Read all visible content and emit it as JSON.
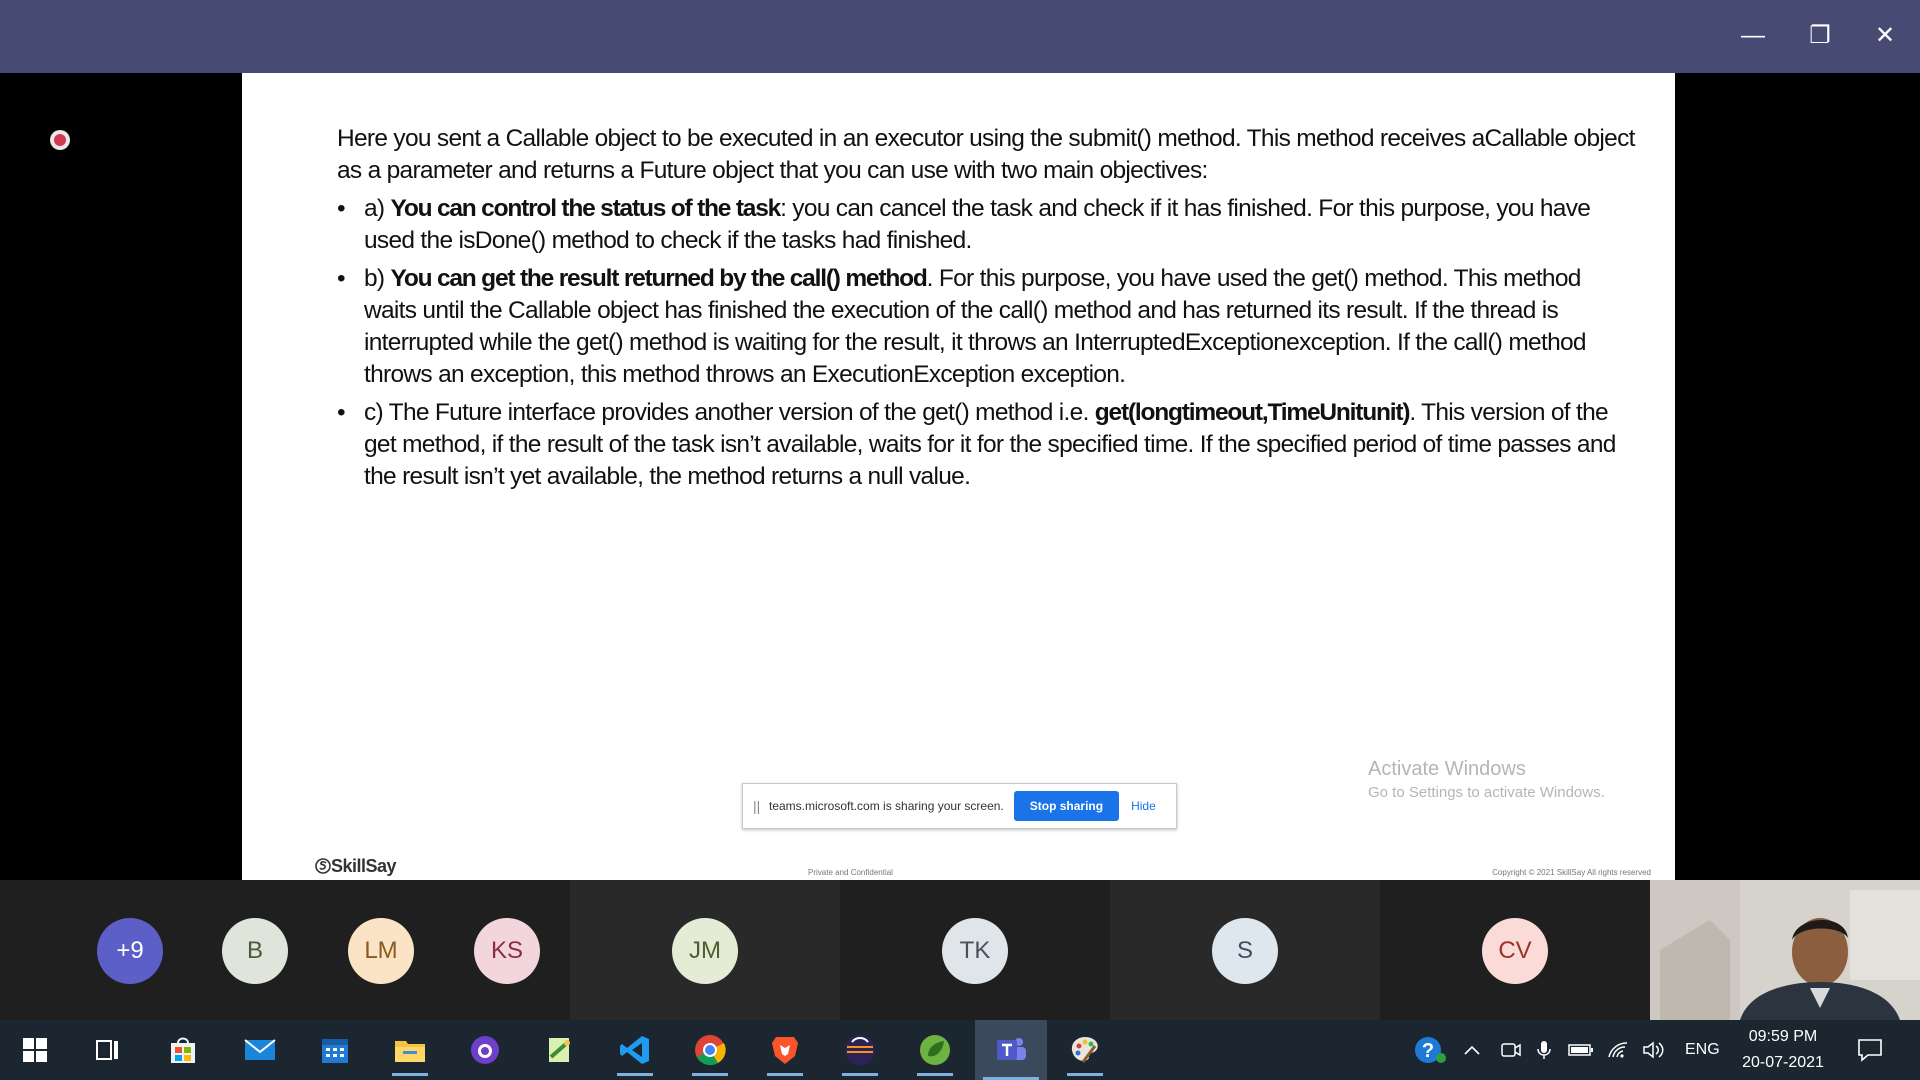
{
  "window": {
    "minimize_glyph": "—",
    "restore_glyph": "❐",
    "close_glyph": "✕"
  },
  "slide": {
    "intro": "Here you sent a Callable object to be executed in an executor using the submit() method. This method receives aCallable object as a parameter and returns a Future object that you can use with two main objectives:",
    "bullets": [
      {
        "prefix": "a) ",
        "bold": "You can control the status of the task",
        "text": ": you can cancel the task and check if it has finished. For this purpose, you have used the isDone() method to check if the tasks had finished."
      },
      {
        "prefix": "b) ",
        "bold": "You can get the result returned by the call() method",
        "text": ". For this purpose, you have used the get() method. This method waits until the Callable object has finished the execution of the call() method and has returned its result. If the thread is interrupted while the get() method is waiting for the result, it throws an InterruptedExceptionexception. If the call() method throws an exception, this method throws an ExecutionException exception."
      },
      {
        "prefix": "c) The Future interface provides another version of the get() method i.e. ",
        "bold": "get(longtimeout,TimeUnitunit)",
        "text": ". This version of the get method, if the result of the task isn’t available, waits for it for the specified time. If the specified period of time passes and the result isn’t yet available, the method returns a null value."
      }
    ],
    "logo": "SkillSay",
    "footer_center": "Private and Confidential",
    "footer_right": "Copyright © 2021 SkillSay All rights reserved"
  },
  "activate_windows": {
    "title": "Activate Windows",
    "subtitle": "Go to Settings to activate Windows."
  },
  "share_bar": {
    "grip": "||",
    "message": "teams.microsoft.com is sharing your screen.",
    "stop_label": "Stop sharing",
    "hide_label": "Hide",
    "accent": "#1a73e8"
  },
  "participants": [
    {
      "initials": "+9",
      "bg": "#5b5fc7",
      "fg": "#ffffff"
    },
    {
      "initials": "B",
      "bg": "#dfe5da",
      "fg": "#4a5a3a"
    },
    {
      "initials": "LM",
      "bg": "#fbe4c6",
      "fg": "#8a5a20"
    },
    {
      "initials": "KS",
      "bg": "#f3d6dc",
      "fg": "#8a2d45"
    },
    {
      "initials": "JM",
      "bg": "#e5ecd6",
      "fg": "#4e5f2f"
    },
    {
      "initials": "TK",
      "bg": "#e0e5ea",
      "fg": "#44525e"
    },
    {
      "initials": "S",
      "bg": "#dfe7ee",
      "fg": "#3d5063"
    },
    {
      "initials": "CV",
      "bg": "#fadbd8",
      "fg": "#9a3426"
    }
  ],
  "taskbar": {
    "apps": [
      "start-icon",
      "task-view-icon",
      "store-icon",
      "mail-icon",
      "calendar-icon",
      "file-explorer-icon",
      "github-desktop-icon",
      "notepad-plus-plus-icon",
      "vscode-icon",
      "chrome-icon",
      "brave-icon",
      "eclipse-icon",
      "spring-tools-icon",
      "teams-icon",
      "paint-icon"
    ],
    "language": "ENG",
    "time": "09:59 PM",
    "date": "20-07-2021"
  }
}
